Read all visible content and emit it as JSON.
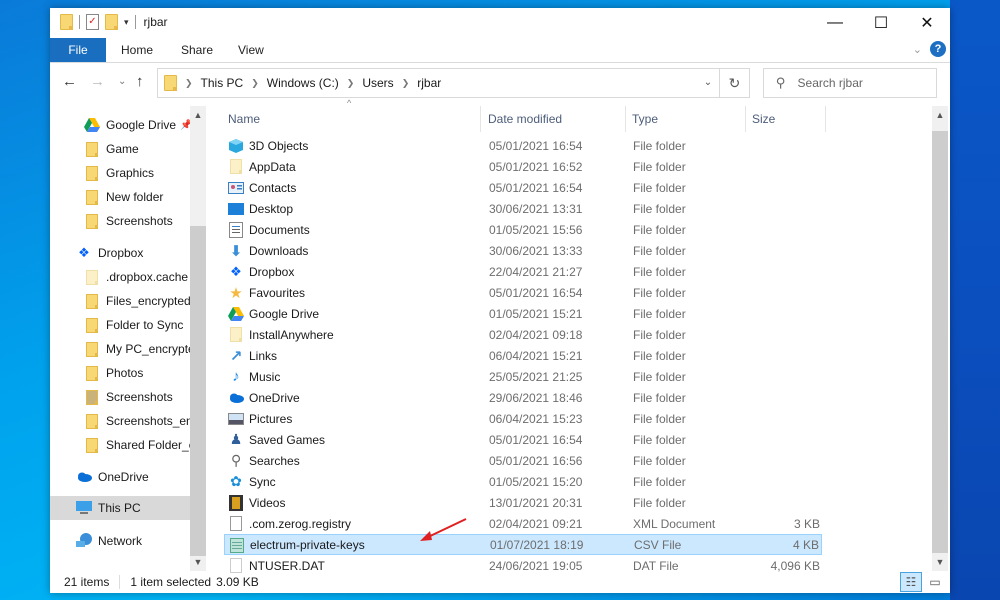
{
  "window": {
    "title": "rjbar",
    "controls": {
      "minimize": "—",
      "maximize": "☐",
      "close": "✕"
    }
  },
  "ribbon": {
    "tabs": [
      "File",
      "Home",
      "Share",
      "View"
    ],
    "help_label": "?",
    "collapse_glyph": "⌄"
  },
  "nav": {
    "back": "←",
    "forward": "→",
    "recent": "⌄",
    "up": "↑",
    "breadcrumb": [
      "This PC",
      "Windows (C:)",
      "Users",
      "rjbar"
    ],
    "refresh": "↻",
    "search_placeholder": "Search rjbar"
  },
  "sidebar": {
    "items": [
      {
        "label": "Google Drive",
        "icon": "google-drive-icon",
        "pinned": true
      },
      {
        "label": "Game",
        "icon": "folder-icon"
      },
      {
        "label": "Graphics",
        "icon": "folder-icon"
      },
      {
        "label": "New folder",
        "icon": "folder-icon"
      },
      {
        "label": "Screenshots",
        "icon": "folder-icon"
      },
      {
        "label": "Dropbox",
        "icon": "dropbox-icon"
      },
      {
        "label": ".dropbox.cache",
        "icon": "folder-hidden-icon"
      },
      {
        "label": "Files_encrypted",
        "icon": "folder-icon"
      },
      {
        "label": "Folder to Sync",
        "icon": "folder-icon"
      },
      {
        "label": "My PC_encrypted",
        "icon": "folder-icon"
      },
      {
        "label": "Photos",
        "icon": "folder-icon"
      },
      {
        "label": "Screenshots",
        "icon": "shared-folder-icon"
      },
      {
        "label": "Screenshots_encrypted",
        "icon": "folder-icon"
      },
      {
        "label": "Shared Folder_encrypted",
        "icon": "folder-icon"
      },
      {
        "label": "OneDrive",
        "icon": "onedrive-icon"
      },
      {
        "label": "This PC",
        "icon": "computer-icon",
        "selected": true
      },
      {
        "label": "Network",
        "icon": "network-icon"
      }
    ]
  },
  "columns": {
    "name": "Name",
    "date": "Date modified",
    "type": "Type",
    "size": "Size"
  },
  "files": [
    {
      "name": "3D Objects",
      "date": "05/01/2021 16:54",
      "type": "File folder",
      "size": "",
      "icon": "3d-objects-icon"
    },
    {
      "name": "AppData",
      "date": "05/01/2021 16:52",
      "type": "File folder",
      "size": "",
      "icon": "folder-hidden-icon"
    },
    {
      "name": "Contacts",
      "date": "05/01/2021 16:54",
      "type": "File folder",
      "size": "",
      "icon": "contacts-icon"
    },
    {
      "name": "Desktop",
      "date": "30/06/2021 13:31",
      "type": "File folder",
      "size": "",
      "icon": "desktop-icon"
    },
    {
      "name": "Documents",
      "date": "01/05/2021 15:56",
      "type": "File folder",
      "size": "",
      "icon": "documents-icon"
    },
    {
      "name": "Downloads",
      "date": "30/06/2021 13:33",
      "type": "File folder",
      "size": "",
      "icon": "downloads-icon"
    },
    {
      "name": "Dropbox",
      "date": "22/04/2021 21:27",
      "type": "File folder",
      "size": "",
      "icon": "dropbox-icon"
    },
    {
      "name": "Favourites",
      "date": "05/01/2021 16:54",
      "type": "File folder",
      "size": "",
      "icon": "star-icon"
    },
    {
      "name": "Google Drive",
      "date": "01/05/2021 15:21",
      "type": "File folder",
      "size": "",
      "icon": "google-drive-icon"
    },
    {
      "name": "InstallAnywhere",
      "date": "02/04/2021 09:18",
      "type": "File folder",
      "size": "",
      "icon": "folder-hidden-icon"
    },
    {
      "name": "Links",
      "date": "06/04/2021 15:21",
      "type": "File folder",
      "size": "",
      "icon": "links-icon"
    },
    {
      "name": "Music",
      "date": "25/05/2021 21:25",
      "type": "File folder",
      "size": "",
      "icon": "music-icon"
    },
    {
      "name": "OneDrive",
      "date": "29/06/2021 18:46",
      "type": "File folder",
      "size": "",
      "icon": "onedrive-icon"
    },
    {
      "name": "Pictures",
      "date": "06/04/2021 15:23",
      "type": "File folder",
      "size": "",
      "icon": "pictures-icon"
    },
    {
      "name": "Saved Games",
      "date": "05/01/2021 16:54",
      "type": "File folder",
      "size": "",
      "icon": "saved-games-icon"
    },
    {
      "name": "Searches",
      "date": "05/01/2021 16:56",
      "type": "File folder",
      "size": "",
      "icon": "search-icon"
    },
    {
      "name": "Sync",
      "date": "01/05/2021 15:20",
      "type": "File folder",
      "size": "",
      "icon": "sync-icon"
    },
    {
      "name": "Videos",
      "date": "13/01/2021 20:31",
      "type": "File folder",
      "size": "",
      "icon": "videos-icon"
    },
    {
      "name": ".com.zerog.registry",
      "date": "02/04/2021 09:21",
      "type": "XML Document",
      "size": "3 KB",
      "icon": "file-icon"
    },
    {
      "name": "electrum-private-keys",
      "date": "01/07/2021 18:19",
      "type": "CSV File",
      "size": "4 KB",
      "icon": "csv-file-icon",
      "selected": true
    },
    {
      "name": "NTUSER.DAT",
      "date": "24/06/2021 19:05",
      "type": "DAT File",
      "size": "4,096 KB",
      "icon": "file-light-icon"
    }
  ],
  "status": {
    "item_count": "21 items",
    "selection": "1 item selected",
    "selection_size": "3.09 KB"
  },
  "colors": {
    "accent": "#1a6ec0",
    "selection_bg": "#cce8ff",
    "selection_border": "#99d1ff",
    "annotation_arrow": "#e02020"
  }
}
